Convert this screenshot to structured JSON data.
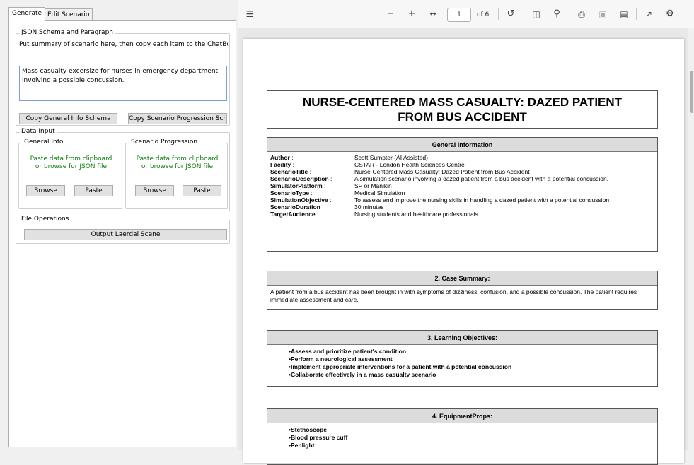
{
  "tabs": [
    {
      "label": "Generate",
      "active": true
    },
    {
      "label": "Edit Scenario",
      "active": false
    }
  ],
  "json_group": {
    "title": "JSON Schema and Paragraph",
    "instruction": "Put summary of scenario here, then copy each item to the ChatBo",
    "input_value": "Mass casualty excersize for nurses in emergency department involving a possible concussion.",
    "copy_general_label": "Copy General Info Schema",
    "copy_progression_label": "Copy Scenario Progression Sch"
  },
  "data_input": {
    "title": "Data Input",
    "general": {
      "title": "General Info",
      "hint_line1": "Paste data from clipboard",
      "hint_line2": "or browse for JSON file",
      "browse_label": "Browse",
      "paste_label": "Paste"
    },
    "progression": {
      "title": "Scenario Progression",
      "hint_line1": "Paste data from clipboard",
      "hint_line2": "or browse for JSON file",
      "browse_label": "Browse",
      "paste_label": "Paste"
    }
  },
  "file_ops": {
    "title": "File Operations",
    "output_label": "Output Laerdal Scene"
  },
  "pdf_toolbar": {
    "current_page": "1",
    "page_count": "of 6",
    "icons": [
      "contents-icon",
      "zoom-out-icon",
      "zoom-in-icon",
      "fit-width-icon",
      "rotate-icon",
      "page-view-icon",
      "find-icon",
      "print-icon",
      "save-icon",
      "save-as-icon",
      "fullscreen-icon",
      "settings-icon"
    ]
  },
  "document": {
    "title_line1": "NURSE-CENTERED MASS CASUALTY: DAZED PATIENT",
    "title_line2": "FROM BUS ACCIDENT",
    "general_info": {
      "heading": "General Information",
      "rows": [
        {
          "key": "Author",
          "value": "Scott Sumpter (AI Assisted)"
        },
        {
          "key": "Facility",
          "value": "CSTAR - London Health Sciences Centre"
        },
        {
          "key": "ScenarioTitle",
          "value": "Nurse-Centered Mass Casualty: Dazed Patient from Bus Accident"
        },
        {
          "key": "ScenarioDescription",
          "value": "A simulation scenario involving a dazed patient from a bus accident with a potential concussion."
        },
        {
          "key": "SimulatorPlatform",
          "value": "SP or Manikin"
        },
        {
          "key": "ScenarioType",
          "value": "Medical Simulation"
        },
        {
          "key": "SimulationObjective",
          "value": "To assess and improve the nursing skills in handling a dazed patient with a potential concussion"
        },
        {
          "key": "ScenarioDuration",
          "value": "30 minutes"
        },
        {
          "key": "TargetAudience",
          "value": "Nursing students and healthcare professionals"
        }
      ]
    },
    "case_summary": {
      "heading": "2. Case Summary:",
      "text": "A patient from a bus accident has been brought in with symptoms of dizziness, confusion, and a possible concussion. The patient requires immediate assessment and care."
    },
    "learning_objectives": {
      "heading": "3. Learning Objectives:",
      "items": [
        "Assess and prioritize patient's condition",
        "Perform a neurological assessment",
        "Implement appropriate interventions for a patient with a potential concussion",
        "Collaborate effectively in a mass casualty scenario"
      ]
    },
    "equipment": {
      "heading": "4. EquipmentProps:",
      "items": [
        "Stethoscope",
        "Blood pressure cuff",
        "Penlight"
      ]
    }
  }
}
